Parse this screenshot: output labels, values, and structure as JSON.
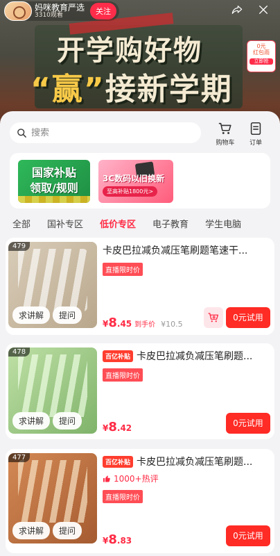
{
  "stream": {
    "host_name": "妈咪教育严选",
    "views": "3310观看",
    "follow_label": "关注",
    "headline_1": "开学购好物",
    "headline_2_highlight": "“赢”",
    "headline_2_rest": "接新学期",
    "side_badge_line1": "0元",
    "side_badge_line2": "红包雨",
    "side_badge_tag": "立即抢"
  },
  "sheet": {
    "search": {
      "placeholder": "搜索"
    },
    "tools": {
      "cart_label": "购物车",
      "orders_label": "订单"
    },
    "banners": {
      "subsidy_line1": "国家补贴",
      "subsidy_line2": "领取/规则",
      "trade_in_title": "3C数码以旧换新",
      "trade_in_sub": "至高补贴1800元>"
    },
    "tabs": [
      "全部",
      "国补专区",
      "低价专区",
      "电子教育",
      "学生电脑"
    ],
    "active_tab_index": 2,
    "products": [
      {
        "rank": "479",
        "badge": "",
        "title": "卡皮巴拉减负减压笔刷题笔速干...",
        "live_tag": "直播限时价",
        "hot": "",
        "price_int": "8",
        "price_dec": ".45",
        "after_label": "到手价",
        "orig_price": "¥10.5",
        "explain_label": "求讲解",
        "ask_label": "提问",
        "try_label": "0元试用"
      },
      {
        "rank": "478",
        "badge": "百亿补贴",
        "title": "卡皮巴拉减负减压笔刷题...",
        "live_tag": "直播限时价",
        "hot": "",
        "price_int": "8",
        "price_dec": ".42",
        "after_label": "",
        "orig_price": "",
        "explain_label": "求讲解",
        "ask_label": "提问",
        "try_label": "0元试用"
      },
      {
        "rank": "477",
        "badge": "百亿补贴",
        "title": "卡皮巴拉减负减压笔刷题...",
        "live_tag": "直播限时价",
        "hot": "1000+热评",
        "price_int": "8",
        "price_dec": ".83",
        "after_label": "",
        "orig_price": "",
        "explain_label": "求讲解",
        "ask_label": "提问",
        "try_label": "0元试用"
      }
    ],
    "currency": "¥"
  },
  "colors": {
    "accent": "#ff2b45",
    "button": "#ff2b25",
    "page_bg": "#f3f3f5"
  }
}
